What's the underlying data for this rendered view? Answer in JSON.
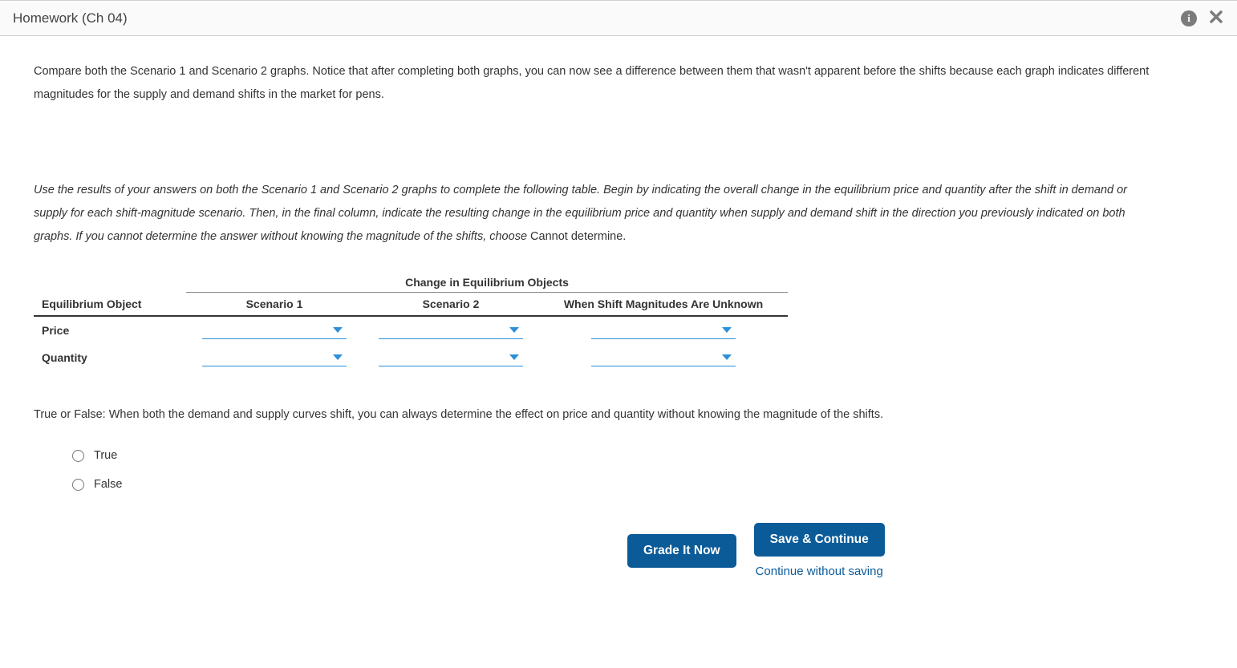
{
  "header": {
    "title": "Homework (Ch 04)"
  },
  "body": {
    "paragraph1": "Compare both the Scenario 1 and Scenario 2 graphs. Notice that after completing both graphs, you can now see a difference between them that wasn't apparent before the shifts because each graph indicates different magnitudes for the supply and demand shifts in the market for pens.",
    "instruction_italic_part": "Use the results of your answers on both the Scenario 1 and Scenario 2 graphs to complete the following table. Begin by indicating the overall change in the equilibrium price and quantity after the shift in demand or supply for each shift-magnitude scenario. Then, in the final column, indicate the resulting change in the equilibrium price and quantity when supply and demand shift in the direction you previously indicated on both graphs. If you cannot determine the answer without knowing the magnitude of the shifts, choose ",
    "instruction_normal_part": "Cannot determine.",
    "table": {
      "super_header": "Change in Equilibrium Objects",
      "col1": "Equilibrium Object",
      "col2": "Scenario 1",
      "col3": "Scenario 2",
      "col4": "When Shift Magnitudes Are Unknown",
      "row1_label": "Price",
      "row2_label": "Quantity"
    },
    "tf_question": "True or False: When both the demand and supply curves shift, you can always determine the effect on price and quantity without knowing the magnitude of the shifts.",
    "option_true": "True",
    "option_false": "False"
  },
  "buttons": {
    "grade": "Grade It Now",
    "save": "Save & Continue",
    "continue_link": "Continue without saving"
  }
}
